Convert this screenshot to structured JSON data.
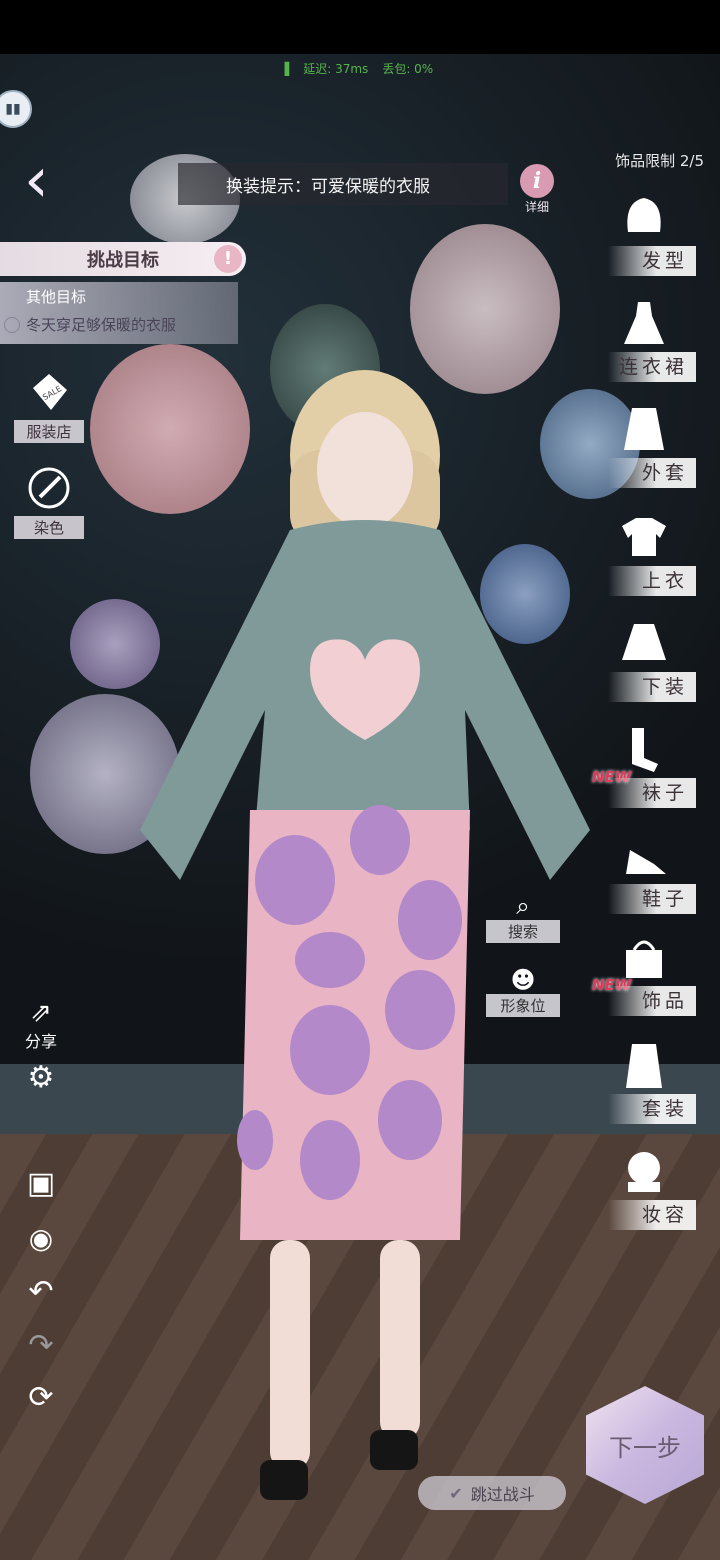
{
  "status": {
    "latency": "延迟: 37ms",
    "packet_loss": "丢包: 0%"
  },
  "hint": {
    "text": "换装提示：可爱保暖的衣服",
    "detail_label": "详细"
  },
  "accessory_limit": "饰品限制 2/5",
  "challenge": {
    "title": "挑战目标",
    "other_goals_title": "其他目标",
    "goal": "冬天穿足够保暖的衣服"
  },
  "left_tools": {
    "shop": "服装店",
    "shop_tag": "SALE",
    "dye": "染色",
    "share": "分享"
  },
  "mini_buttons": {
    "search": "搜索",
    "image_slot": "形象位"
  },
  "categories": [
    {
      "label": "发型",
      "icon": "hair-icon",
      "new": false
    },
    {
      "label": "连衣裙",
      "icon": "dress-icon",
      "new": false
    },
    {
      "label": "外套",
      "icon": "coat-icon",
      "new": false
    },
    {
      "label": "上衣",
      "icon": "top-icon",
      "new": false
    },
    {
      "label": "下装",
      "icon": "skirt-icon",
      "new": false
    },
    {
      "label": "袜子",
      "icon": "socks-icon",
      "new": true
    },
    {
      "label": "鞋子",
      "icon": "heels-icon",
      "new": false
    },
    {
      "label": "饰品",
      "icon": "bag-icon",
      "new": true
    },
    {
      "label": "套装",
      "icon": "suit-icon",
      "new": false
    },
    {
      "label": "妆容",
      "icon": "makeup-icon",
      "new": false
    }
  ],
  "new_badge": "NEW",
  "next_button": "下一步",
  "skip_button": "跳过战斗",
  "colors": {
    "sweater": "#7f9a98",
    "skirt": "#e9b4c4",
    "skirt_patches": "#b389c9",
    "hint_pink": "#d99bb1",
    "new_red": "#e03a5a"
  }
}
